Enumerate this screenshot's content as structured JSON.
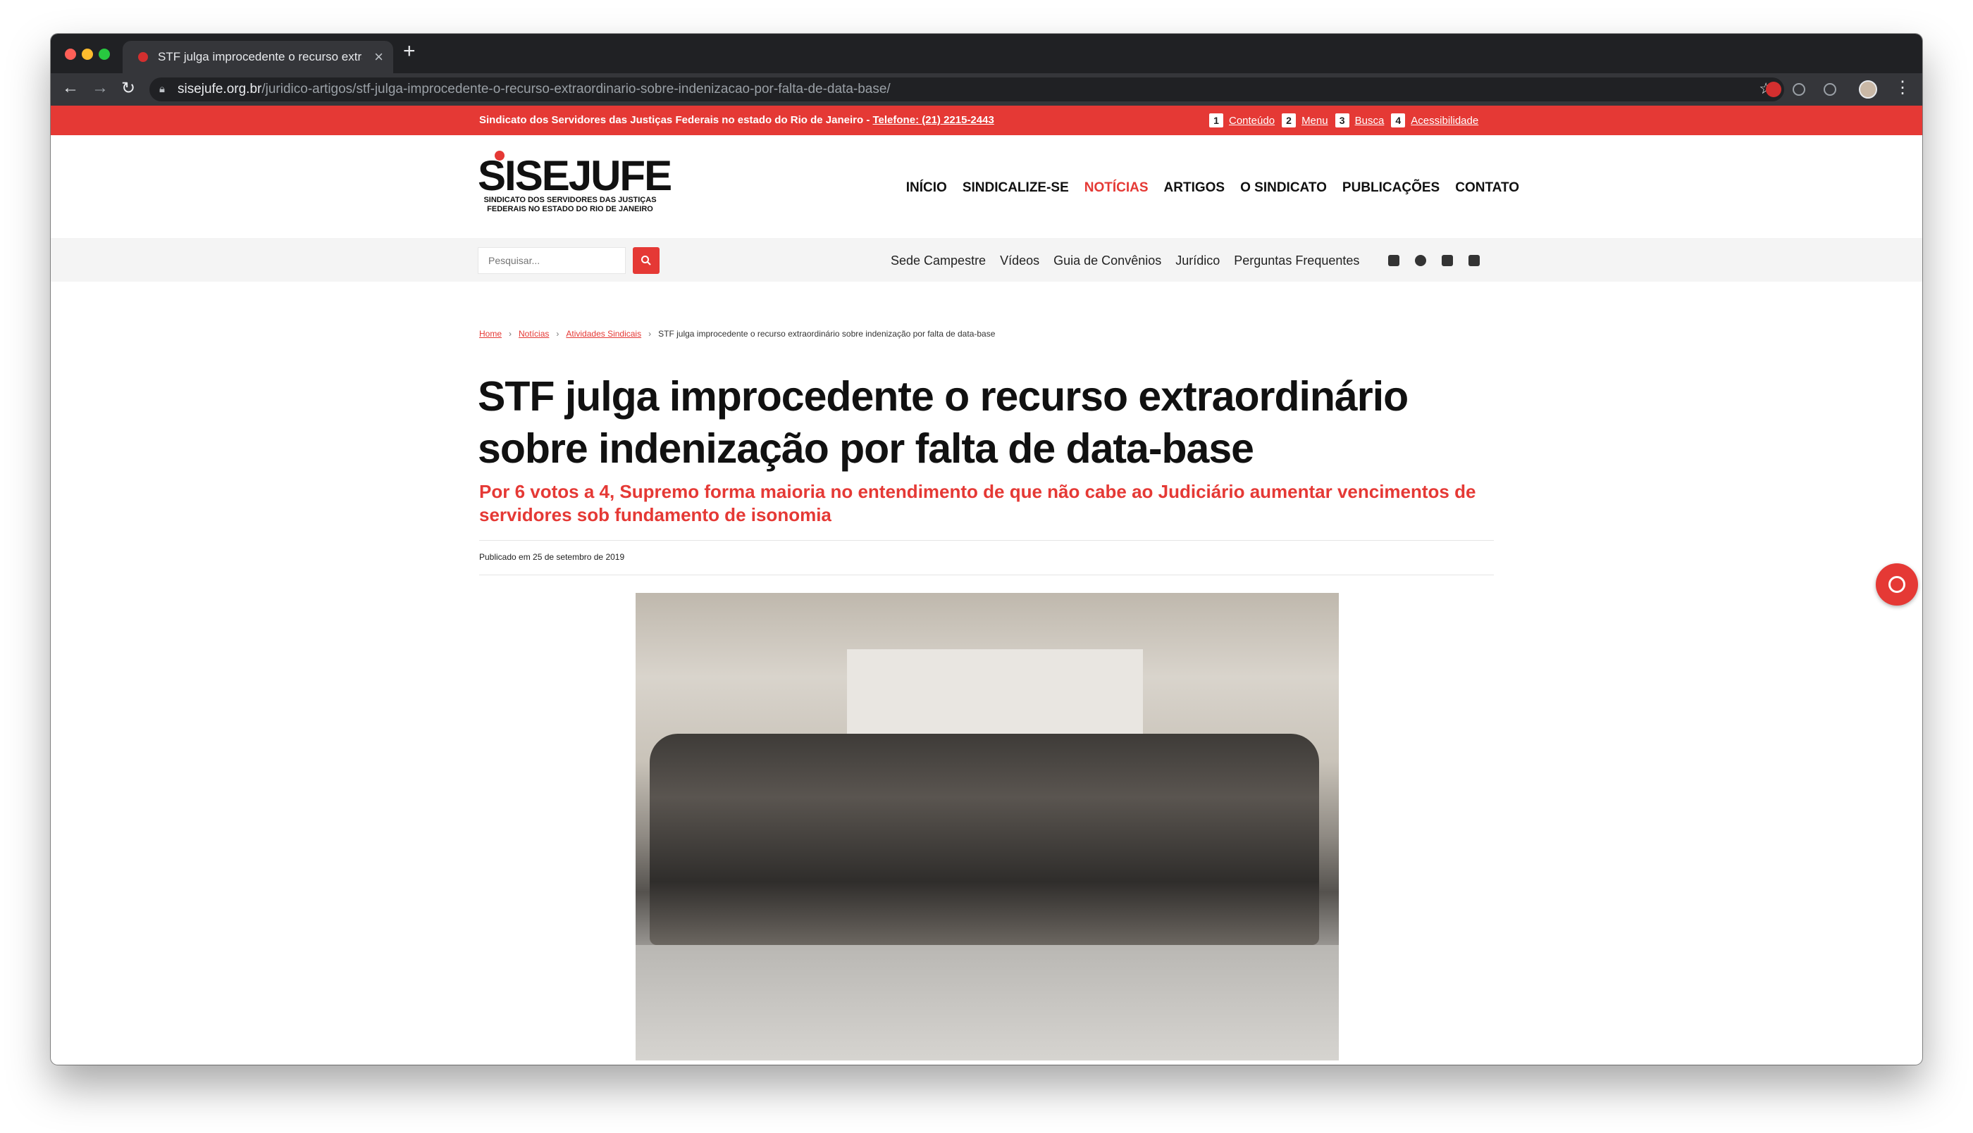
{
  "browser": {
    "tab_title": "STF julga improcedente o recurso extraordinário sobre indenização por falta de data-base",
    "url_host": "sisejufe.org.br",
    "url_path": "/juridico-artigos/stf-julga-improcedente-o-recurso-extraordinario-sobre-indenizacao-por-falta-de-data-base/"
  },
  "topbar": {
    "org_text": "Sindicato dos Servidores das Justiças Federais no estado do Rio de Janeiro - ",
    "phone": "Telefone: (21) 2215-2443",
    "skip_links": [
      {
        "num": "1",
        "label": "Conteúdo"
      },
      {
        "num": "2",
        "label": "Menu"
      },
      {
        "num": "3",
        "label": "Busca"
      },
      {
        "num": "4",
        "label": "Acessibilidade"
      }
    ]
  },
  "logo": {
    "word": "SISEJUFE",
    "tagline_1": "SINDICATO DOS SERVIDORES DAS JUSTIÇAS",
    "tagline_2": "FEDERAIS NO ESTADO DO RIO DE JANEIRO"
  },
  "main_nav": [
    "INÍCIO",
    "SINDICALIZE-SE",
    "NOTÍCIAS",
    "ARTIGOS",
    "O SINDICATO",
    "PUBLICAÇÕES",
    "CONTATO"
  ],
  "main_nav_active": "NOTÍCIAS",
  "search": {
    "placeholder": "Pesquisar..."
  },
  "sub_nav": [
    "Sede Campestre",
    "Vídeos",
    "Guia de Convênios",
    "Jurídico",
    "Perguntas Frequentes"
  ],
  "social_icons": [
    "facebook-icon",
    "instagram-icon",
    "twitter-icon",
    "youtube-icon"
  ],
  "breadcrumb": {
    "items": [
      "Home",
      "Notícias",
      "Atividades Sindicais"
    ],
    "current": "STF julga improcedente o recurso extraordinário sobre indenização por falta de data-base"
  },
  "article": {
    "title": "STF julga improcedente o recurso extraordinário sobre indenização por falta de data-base",
    "subtitle": "Por 6 votos a 4, Supremo forma maioria no entendimento de que não cabe ao Judiciário aumentar vencimentos de servidores sob fundamento de isonomia",
    "published": "Publicado em 25 de setembro de 2019"
  },
  "colors": {
    "brand_red": "#e53935",
    "text_dark": "#111111"
  }
}
